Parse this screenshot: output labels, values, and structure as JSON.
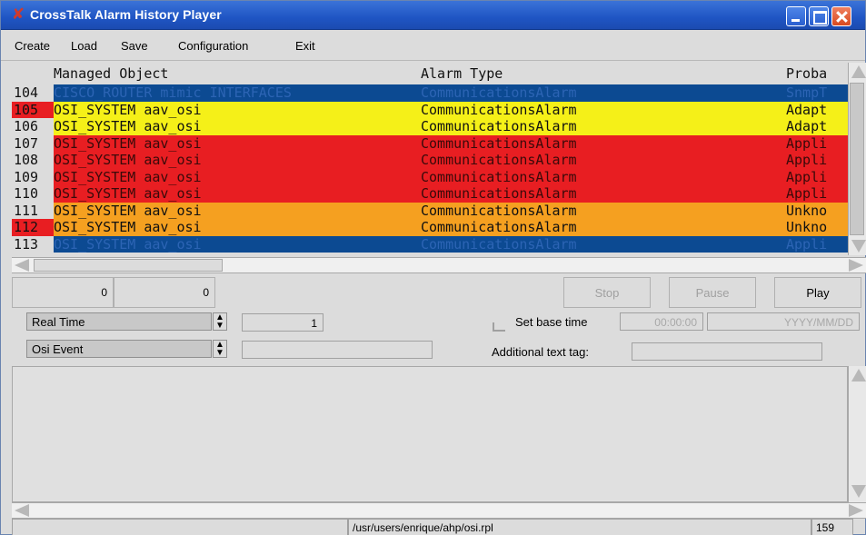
{
  "window": {
    "title": "CrossTalk Alarm History Player",
    "app_icon": "x-logo-icon",
    "title_bar_color": "#1f55c4"
  },
  "menu": [
    "Create",
    "Load",
    "Save",
    "Configuration",
    "Exit"
  ],
  "table": {
    "columns": [
      "Managed Object",
      "Alarm Type",
      "Proba"
    ],
    "rows": [
      {
        "num": "104",
        "object": "CISCO_ROUTER mimic INTERFACES",
        "alarm_type": "CommunicationsAlarm",
        "cause": "SnmpT",
        "bg": "#0c4a92",
        "fg": "#2c64b4",
        "num_alert": false
      },
      {
        "num": "105",
        "object": "OSI_SYSTEM aav_osi",
        "alarm_type": "CommunicationsAlarm",
        "cause": "Adapt",
        "bg": "#f5f018",
        "fg": "#111111",
        "num_alert": true
      },
      {
        "num": "106",
        "object": "OSI_SYSTEM aav_osi",
        "alarm_type": "CommunicationsAlarm",
        "cause": "Adapt",
        "bg": "#f5f018",
        "fg": "#111111",
        "num_alert": false
      },
      {
        "num": "107",
        "object": "OSI_SYSTEM aav_osi",
        "alarm_type": "CommunicationsAlarm",
        "cause": "Appli",
        "bg": "#e81e22",
        "fg": "#3a0a0a",
        "num_alert": false
      },
      {
        "num": "108",
        "object": "OSI_SYSTEM aav_osi",
        "alarm_type": "CommunicationsAlarm",
        "cause": "Appli",
        "bg": "#e81e22",
        "fg": "#3a0a0a",
        "num_alert": false
      },
      {
        "num": "109",
        "object": "OSI_SYSTEM aav_osi",
        "alarm_type": "CommunicationsAlarm",
        "cause": "Appli",
        "bg": "#e81e22",
        "fg": "#3a0a0a",
        "num_alert": false
      },
      {
        "num": "110",
        "object": "OSI_SYSTEM aav_osi",
        "alarm_type": "CommunicationsAlarm",
        "cause": "Appli",
        "bg": "#e81e22",
        "fg": "#3a0a0a",
        "num_alert": false
      },
      {
        "num": "111",
        "object": "OSI_SYSTEM aav_osi",
        "alarm_type": "CommunicationsAlarm",
        "cause": "Unkno",
        "bg": "#f5a020",
        "fg": "#111111",
        "num_alert": false
      },
      {
        "num": "112",
        "object": "OSI_SYSTEM aav_osi",
        "alarm_type": "CommunicationsAlarm",
        "cause": "Unkno",
        "bg": "#f5a020",
        "fg": "#111111",
        "num_alert": true
      },
      {
        "num": "113",
        "object": "OSI_SYSTEM aav_osi",
        "alarm_type": "CommunicationsAlarm",
        "cause": "Appli",
        "bg": "#0c4a92",
        "fg": "#2c64b4",
        "num_alert": false
      }
    ]
  },
  "controls": {
    "counter_left": "0",
    "counter_right": "0",
    "stop_label": "Stop",
    "pause_label": "Pause",
    "play_label": "Play",
    "mode_select": "Real Time",
    "speed_value": "1",
    "event_select": "Osi Event",
    "event_filter": "",
    "set_base_time_label": "Set base time",
    "base_time": "00:00:00",
    "base_date": "YYYY/MM/DD",
    "additional_text_tag_label": "Additional text tag:",
    "additional_text_tag_value": ""
  },
  "status": {
    "file_path": "/usr/users/enrique/ahp/osi.rpl",
    "count": "159"
  }
}
